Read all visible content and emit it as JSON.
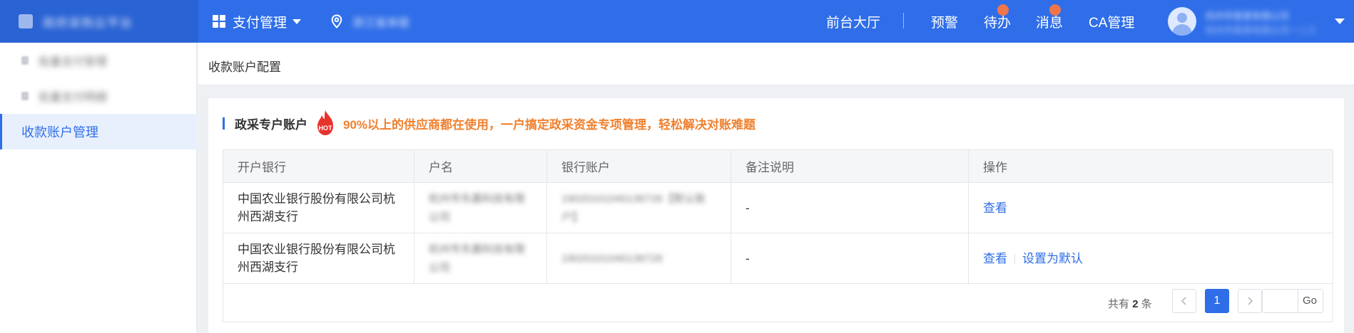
{
  "header": {
    "brand_name": "政府采购云平台",
    "menu_label": "支付管理",
    "location_label": "浙江省本级",
    "links": [
      "前台大厅",
      "预警",
      "待办",
      "消息",
      "CA管理"
    ],
    "user_name": "杭州市某某有限公司",
    "user_org": "杭州市某某有限公司一二三"
  },
  "sidebar": {
    "items": [
      {
        "label": "批量支付管理",
        "active": false
      },
      {
        "label": "批量支付明细",
        "active": false
      },
      {
        "label": "收款账户管理",
        "active": true
      }
    ]
  },
  "breadcrumb": "收款账户配置",
  "section": {
    "title": "政采专户账户",
    "hot_badge": "HOT",
    "promo": "90%以上的供应商都在使用，一户搞定政采资金专项管理，轻松解决对账难题"
  },
  "table": {
    "columns": [
      "开户银行",
      "户名",
      "银行账户",
      "备注说明",
      "操作"
    ],
    "rows": [
      {
        "bank": "中国农业银行股份有限公司杭州西湖支行",
        "account_name": "杭州市东晨科技有限公司",
        "account_no": "19020101040136726【默认账户】",
        "remark": "-",
        "actions": [
          "查看"
        ]
      },
      {
        "bank": "中国农业银行股份有限公司杭州西湖支行",
        "account_name": "杭州市东晨科技有限公司",
        "account_no": "19020101040136726",
        "remark": "-",
        "actions": [
          "查看",
          "设置为默认"
        ]
      }
    ]
  },
  "pagination": {
    "total_prefix": "共有",
    "total_count": "2",
    "total_suffix": "条",
    "current_page": "1",
    "go_label": "Go"
  },
  "colors": {
    "primary": "#2f6ee8",
    "promo": "#f0802e",
    "badge": "#f0754a"
  }
}
